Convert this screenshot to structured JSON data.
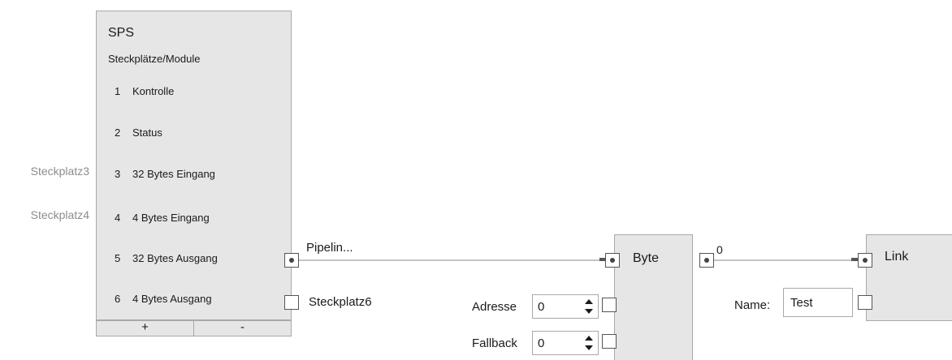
{
  "sps_node": {
    "title": "SPS",
    "subtitle": "Steckplätze/Module",
    "slots": [
      {
        "num": "1",
        "label": "Kontrolle"
      },
      {
        "num": "2",
        "label": "Status"
      },
      {
        "num": "3",
        "label": "32 Bytes Eingang"
      },
      {
        "num": "4",
        "label": "4 Bytes Eingang"
      },
      {
        "num": "5",
        "label": "32 Bytes Ausgang"
      },
      {
        "num": "6",
        "label": "4 Bytes Ausgang"
      }
    ],
    "side_labels": {
      "slot3": "Steckplatz3",
      "slot4": "Steckplatz4"
    },
    "add_label": "+",
    "remove_label": "-",
    "port5_label": "Pipelin...",
    "port6_label": "Steckplatz6"
  },
  "byte_node": {
    "title": "Byte",
    "output_value": "0",
    "address": {
      "label": "Adresse",
      "value": "0"
    },
    "fallback": {
      "label": "Fallback",
      "value": "0"
    }
  },
  "link_node": {
    "title": "Link",
    "name": {
      "label": "Name:",
      "value": "Test"
    }
  },
  "colors": {
    "node_bg": "#e6e6e6",
    "border": "#a9a9a9",
    "wire": "#c4c4c4",
    "side_label": "#8c8c8c"
  }
}
